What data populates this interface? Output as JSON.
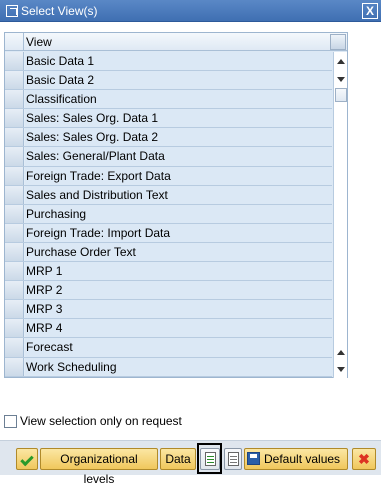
{
  "window": {
    "title": "Select View(s)",
    "close_symbol": "X"
  },
  "table": {
    "column_header": "View",
    "rows": [
      "Basic Data 1",
      "Basic Data 2",
      "Classification",
      "Sales: Sales Org. Data 1",
      "Sales: Sales Org. Data 2",
      "Sales: General/Plant Data",
      "Foreign Trade: Export Data",
      "Sales and Distribution Text",
      "Purchasing",
      "Foreign Trade: Import Data",
      "Purchase Order Text",
      "MRP 1",
      "MRP 2",
      "MRP 3",
      "MRP 4",
      "Forecast",
      "Work Scheduling"
    ]
  },
  "options": {
    "view_selection_label": "View selection only on request"
  },
  "toolbar": {
    "org_levels_label": "Organizational levels",
    "data_label": "Data",
    "default_values_label": "Default values",
    "cancel_symbol": "✖"
  }
}
